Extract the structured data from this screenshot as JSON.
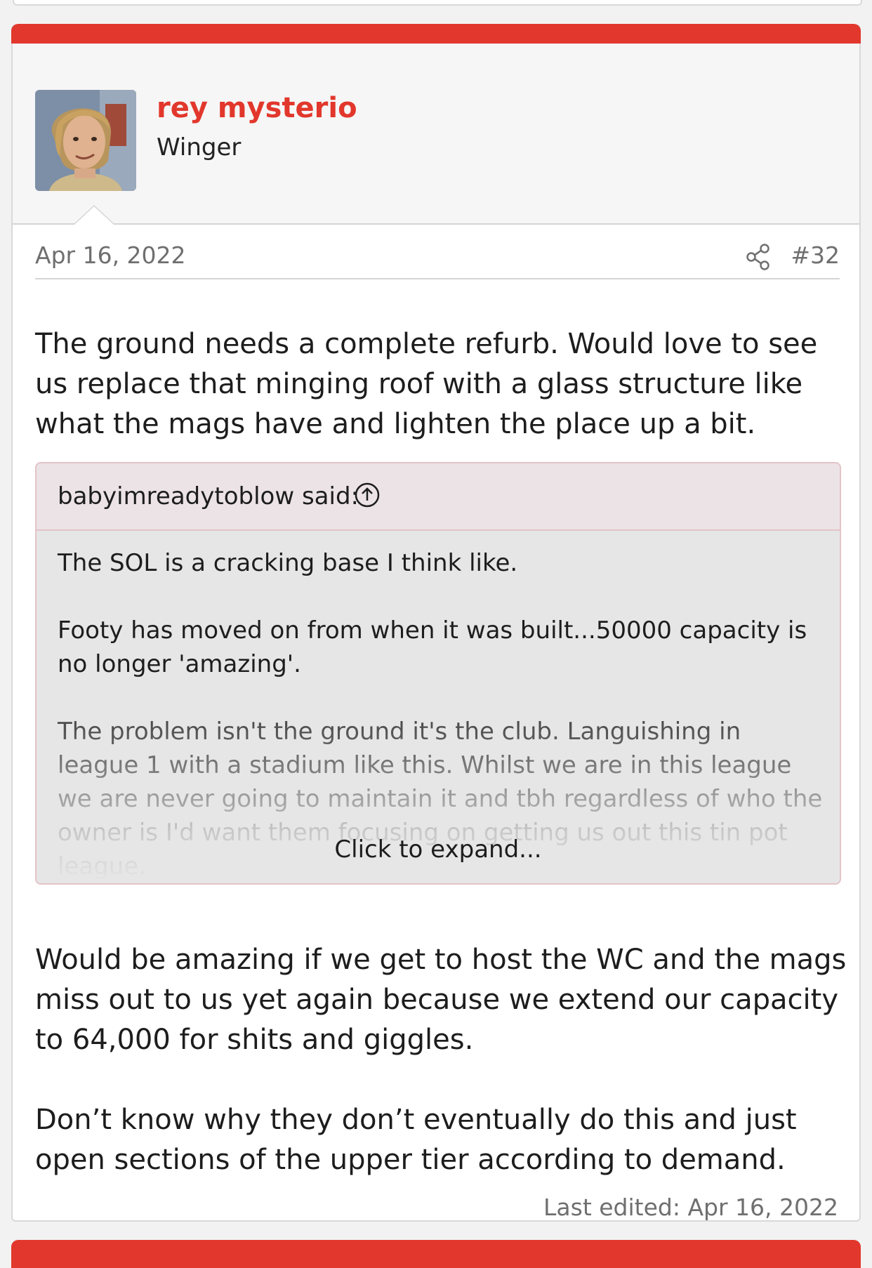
{
  "post": {
    "username": "rey mysterio",
    "user_title": "Winger",
    "date": "Apr 16, 2022",
    "number": "#32",
    "body_intro": "The ground needs a complete refurb. Would love to see us replace that minging roof with a glass structure like what the mags have and lighten the place up a bit.",
    "quote": {
      "author": "babyimreadytoblow said:",
      "paragraphs": [
        "The SOL is a cracking base I think like.",
        "Footy has moved on from when it was built...50000 capacity is no longer 'amazing'.",
        "The problem isn't the ground it's the club. Languishing in league 1 with a stadium like this. Whilst we are in this league we are never going to maintain it and tbh regardless of who the owner is I'd want them focusing on getting us out this tin pot league."
      ],
      "expand_label": "Click to expand..."
    },
    "body_paragraphs": [
      "Would be amazing if we get to host the WC and the mags miss out to us yet again because we extend our capacity to 64,000 for shits and giggles.",
      "Don’t know why they don’t eventually do this and just open sections of the upper tier according to demand."
    ],
    "last_edited": "Last edited: Apr 16, 2022"
  },
  "icons": {
    "share": "share-icon",
    "quote_jump": "arrow-up-circle-icon"
  },
  "colors": {
    "accent": "#e2372c",
    "quote_header_bg": "#ece3e6",
    "quote_bg": "#e6e6e6"
  }
}
